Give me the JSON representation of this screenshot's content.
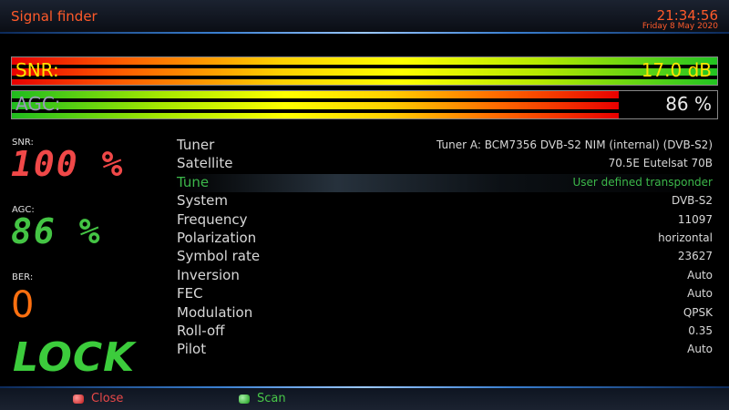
{
  "header": {
    "title": "Signal finder",
    "time": "21:34:56",
    "date": "Friday  8 May 2020"
  },
  "snr_bar": {
    "label": "SNR:",
    "value": "17.0 dB"
  },
  "agc_bar": {
    "label": "AGC:",
    "value": "86 %",
    "level": 0.86
  },
  "left": {
    "snr_label": "SNR:",
    "snr_value": "100 %",
    "agc_label": "AGC:",
    "agc_value": "86 %",
    "ber_label": "BER:",
    "ber_value": "0",
    "lock": "LOCK"
  },
  "info": [
    {
      "key": "Tuner",
      "value": "Tuner A: BCM7356 DVB-S2 NIM (internal) (DVB-S2)"
    },
    {
      "key": "Satellite",
      "value": "70.5E Eutelsat 70B"
    },
    {
      "key": "Tune",
      "value": "User defined transponder"
    },
    {
      "key": "System",
      "value": "DVB-S2"
    },
    {
      "key": "Frequency",
      "value": "11097"
    },
    {
      "key": "Polarization",
      "value": "horizontal"
    },
    {
      "key": "Symbol rate",
      "value": "23627"
    },
    {
      "key": "Inversion",
      "value": "Auto"
    },
    {
      "key": "FEC",
      "value": "Auto"
    },
    {
      "key": "Modulation",
      "value": "QPSK"
    },
    {
      "key": "Roll-off",
      "value": "0.35"
    },
    {
      "key": "Pilot",
      "value": "Auto"
    }
  ],
  "footer": {
    "close_label": "Close",
    "scan_label": "Scan"
  },
  "colors": {
    "header_text": "#ff5a2a",
    "selected_row": "#3cb84a",
    "lock": "#3ccc3c",
    "snr_reading": "#f04848",
    "agc_reading": "#44c444",
    "ber_reading": "#ff7010"
  }
}
